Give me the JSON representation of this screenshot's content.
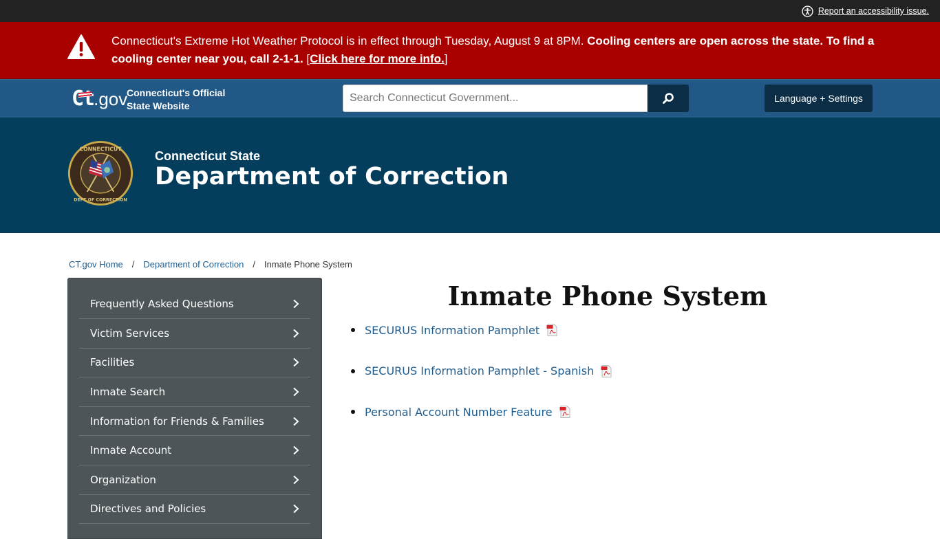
{
  "utility": {
    "accessibility_icon": "accessibility-icon",
    "accessibility_link": "Report an accessibility issue."
  },
  "alert": {
    "icon": "warning-icon",
    "text_normal": "Connecticut's Extreme Hot Weather Protocol is in effect through Tuesday, August 9 at 8PM. ",
    "text_bold": "Cooling centers are open across the state. To find a cooling center near you, call 2-1-1.",
    "link_open": " [",
    "link_text": "Click here for more info.",
    "link_close": "]",
    "background": "#a90000"
  },
  "ctbar": {
    "logo_ct": "Ct",
    "logo_gov": ".gov",
    "tagline_line1": "Connecticut's Official",
    "tagline_line2": "State Website",
    "search_placeholder": "Search Connecticut Government...",
    "search_value": "",
    "search_button_icon": "search-icon",
    "language_button": "Language + Settings",
    "background": "#215886"
  },
  "agency": {
    "seal": "department-of-correction-seal",
    "subtitle": "Connecticut State",
    "title": "Department of Correction",
    "background": "#053d5c"
  },
  "breadcrumb": {
    "items": [
      {
        "label": "CT.gov Home"
      },
      {
        "label": "Department of Correction"
      }
    ],
    "separator": "/",
    "current": "Inmate Phone System"
  },
  "sidebar": {
    "items": [
      {
        "label": "Frequently Asked Questions"
      },
      {
        "label": "Victim Services"
      },
      {
        "label": "Facilities"
      },
      {
        "label": "Inmate Search"
      },
      {
        "label": "Information for Friends & Families"
      },
      {
        "label": "Inmate Account"
      },
      {
        "label": "Organization"
      },
      {
        "label": "Directives and Policies"
      }
    ],
    "background": "#4d5559"
  },
  "main": {
    "title": "Inmate Phone System",
    "documents": [
      {
        "label": "SECURUS Information Pamphlet",
        "icon": "pdf-icon"
      },
      {
        "label": "SECURUS Information Pamphlet - Spanish",
        "icon": "pdf-icon"
      },
      {
        "label": "Personal Account Number Feature",
        "icon": "pdf-icon"
      }
    ],
    "link_color": "#1f5d8f"
  }
}
